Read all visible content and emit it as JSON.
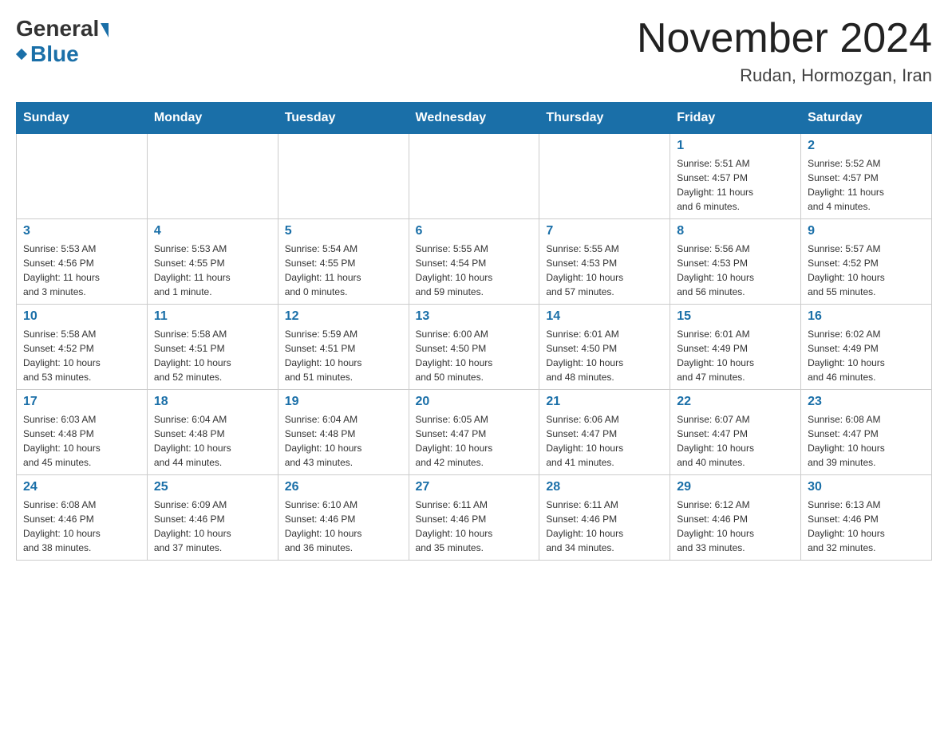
{
  "header": {
    "title": "November 2024",
    "subtitle": "Rudan, Hormozgan, Iran",
    "logo_general": "General",
    "logo_blue": "Blue"
  },
  "weekdays": [
    "Sunday",
    "Monday",
    "Tuesday",
    "Wednesday",
    "Thursday",
    "Friday",
    "Saturday"
  ],
  "weeks": [
    [
      {
        "day": "",
        "info": ""
      },
      {
        "day": "",
        "info": ""
      },
      {
        "day": "",
        "info": ""
      },
      {
        "day": "",
        "info": ""
      },
      {
        "day": "",
        "info": ""
      },
      {
        "day": "1",
        "info": "Sunrise: 5:51 AM\nSunset: 4:57 PM\nDaylight: 11 hours\nand 6 minutes."
      },
      {
        "day": "2",
        "info": "Sunrise: 5:52 AM\nSunset: 4:57 PM\nDaylight: 11 hours\nand 4 minutes."
      }
    ],
    [
      {
        "day": "3",
        "info": "Sunrise: 5:53 AM\nSunset: 4:56 PM\nDaylight: 11 hours\nand 3 minutes."
      },
      {
        "day": "4",
        "info": "Sunrise: 5:53 AM\nSunset: 4:55 PM\nDaylight: 11 hours\nand 1 minute."
      },
      {
        "day": "5",
        "info": "Sunrise: 5:54 AM\nSunset: 4:55 PM\nDaylight: 11 hours\nand 0 minutes."
      },
      {
        "day": "6",
        "info": "Sunrise: 5:55 AM\nSunset: 4:54 PM\nDaylight: 10 hours\nand 59 minutes."
      },
      {
        "day": "7",
        "info": "Sunrise: 5:55 AM\nSunset: 4:53 PM\nDaylight: 10 hours\nand 57 minutes."
      },
      {
        "day": "8",
        "info": "Sunrise: 5:56 AM\nSunset: 4:53 PM\nDaylight: 10 hours\nand 56 minutes."
      },
      {
        "day": "9",
        "info": "Sunrise: 5:57 AM\nSunset: 4:52 PM\nDaylight: 10 hours\nand 55 minutes."
      }
    ],
    [
      {
        "day": "10",
        "info": "Sunrise: 5:58 AM\nSunset: 4:52 PM\nDaylight: 10 hours\nand 53 minutes."
      },
      {
        "day": "11",
        "info": "Sunrise: 5:58 AM\nSunset: 4:51 PM\nDaylight: 10 hours\nand 52 minutes."
      },
      {
        "day": "12",
        "info": "Sunrise: 5:59 AM\nSunset: 4:51 PM\nDaylight: 10 hours\nand 51 minutes."
      },
      {
        "day": "13",
        "info": "Sunrise: 6:00 AM\nSunset: 4:50 PM\nDaylight: 10 hours\nand 50 minutes."
      },
      {
        "day": "14",
        "info": "Sunrise: 6:01 AM\nSunset: 4:50 PM\nDaylight: 10 hours\nand 48 minutes."
      },
      {
        "day": "15",
        "info": "Sunrise: 6:01 AM\nSunset: 4:49 PM\nDaylight: 10 hours\nand 47 minutes."
      },
      {
        "day": "16",
        "info": "Sunrise: 6:02 AM\nSunset: 4:49 PM\nDaylight: 10 hours\nand 46 minutes."
      }
    ],
    [
      {
        "day": "17",
        "info": "Sunrise: 6:03 AM\nSunset: 4:48 PM\nDaylight: 10 hours\nand 45 minutes."
      },
      {
        "day": "18",
        "info": "Sunrise: 6:04 AM\nSunset: 4:48 PM\nDaylight: 10 hours\nand 44 minutes."
      },
      {
        "day": "19",
        "info": "Sunrise: 6:04 AM\nSunset: 4:48 PM\nDaylight: 10 hours\nand 43 minutes."
      },
      {
        "day": "20",
        "info": "Sunrise: 6:05 AM\nSunset: 4:47 PM\nDaylight: 10 hours\nand 42 minutes."
      },
      {
        "day": "21",
        "info": "Sunrise: 6:06 AM\nSunset: 4:47 PM\nDaylight: 10 hours\nand 41 minutes."
      },
      {
        "day": "22",
        "info": "Sunrise: 6:07 AM\nSunset: 4:47 PM\nDaylight: 10 hours\nand 40 minutes."
      },
      {
        "day": "23",
        "info": "Sunrise: 6:08 AM\nSunset: 4:47 PM\nDaylight: 10 hours\nand 39 minutes."
      }
    ],
    [
      {
        "day": "24",
        "info": "Sunrise: 6:08 AM\nSunset: 4:46 PM\nDaylight: 10 hours\nand 38 minutes."
      },
      {
        "day": "25",
        "info": "Sunrise: 6:09 AM\nSunset: 4:46 PM\nDaylight: 10 hours\nand 37 minutes."
      },
      {
        "day": "26",
        "info": "Sunrise: 6:10 AM\nSunset: 4:46 PM\nDaylight: 10 hours\nand 36 minutes."
      },
      {
        "day": "27",
        "info": "Sunrise: 6:11 AM\nSunset: 4:46 PM\nDaylight: 10 hours\nand 35 minutes."
      },
      {
        "day": "28",
        "info": "Sunrise: 6:11 AM\nSunset: 4:46 PM\nDaylight: 10 hours\nand 34 minutes."
      },
      {
        "day": "29",
        "info": "Sunrise: 6:12 AM\nSunset: 4:46 PM\nDaylight: 10 hours\nand 33 minutes."
      },
      {
        "day": "30",
        "info": "Sunrise: 6:13 AM\nSunset: 4:46 PM\nDaylight: 10 hours\nand 32 minutes."
      }
    ]
  ]
}
